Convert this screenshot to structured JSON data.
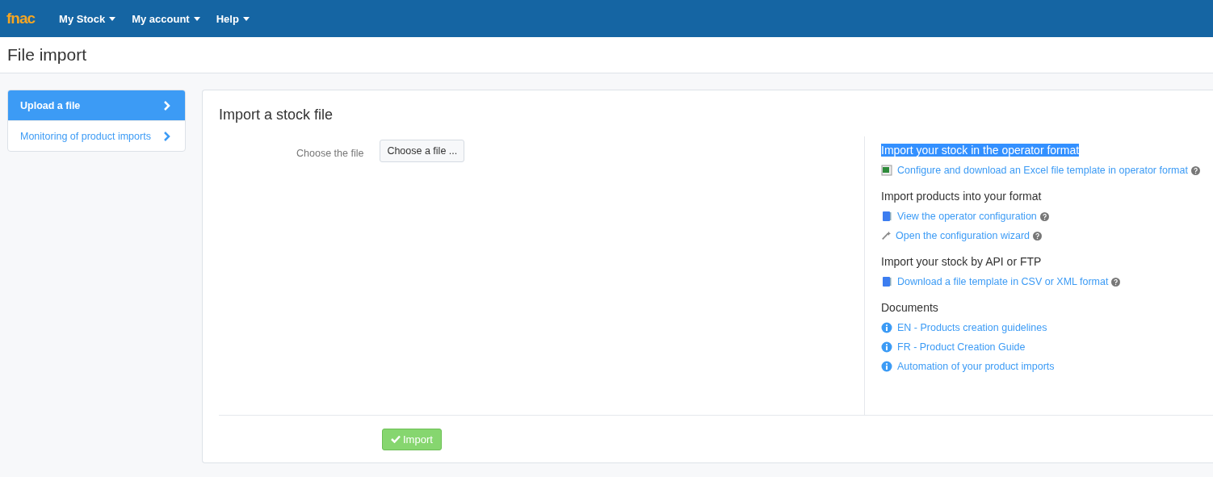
{
  "navbar": {
    "logo": "fnac",
    "menus": [
      {
        "label": "My Stock"
      },
      {
        "label": "My account"
      },
      {
        "label": "Help"
      }
    ]
  },
  "page_title": "File import",
  "sidebar": {
    "items": [
      {
        "label": "Upload a file",
        "selected": true
      },
      {
        "label": "Monitoring of product imports",
        "selected": false
      }
    ]
  },
  "panel": {
    "title": "Import a stock file",
    "file_label": "Choose the file",
    "file_button": "Choose a file ...",
    "sections": [
      {
        "heading": "Import your stock in the operator format",
        "highlighted": true,
        "links": [
          {
            "kind": "excel",
            "label": "Configure and download an Excel file template in operator format",
            "help": true
          }
        ]
      },
      {
        "heading": "Import products into your format",
        "highlighted": false,
        "links": [
          {
            "kind": "book",
            "label": "View the operator configuration",
            "help": true
          },
          {
            "kind": "wand",
            "label": "Open the configuration wizard",
            "help": true
          }
        ]
      },
      {
        "heading": "Import your stock by API or FTP",
        "highlighted": false,
        "links": [
          {
            "kind": "book",
            "label": "Download a file template in CSV or XML format",
            "help": true
          }
        ]
      },
      {
        "heading": "Documents",
        "highlighted": false,
        "links": [
          {
            "kind": "info",
            "label": "EN - Products creation guidelines",
            "help": false
          },
          {
            "kind": "info",
            "label": "FR - Product Creation Guide",
            "help": false
          },
          {
            "kind": "info",
            "label": "Automation of your product imports",
            "help": false
          }
        ]
      }
    ],
    "submit": "Import"
  }
}
